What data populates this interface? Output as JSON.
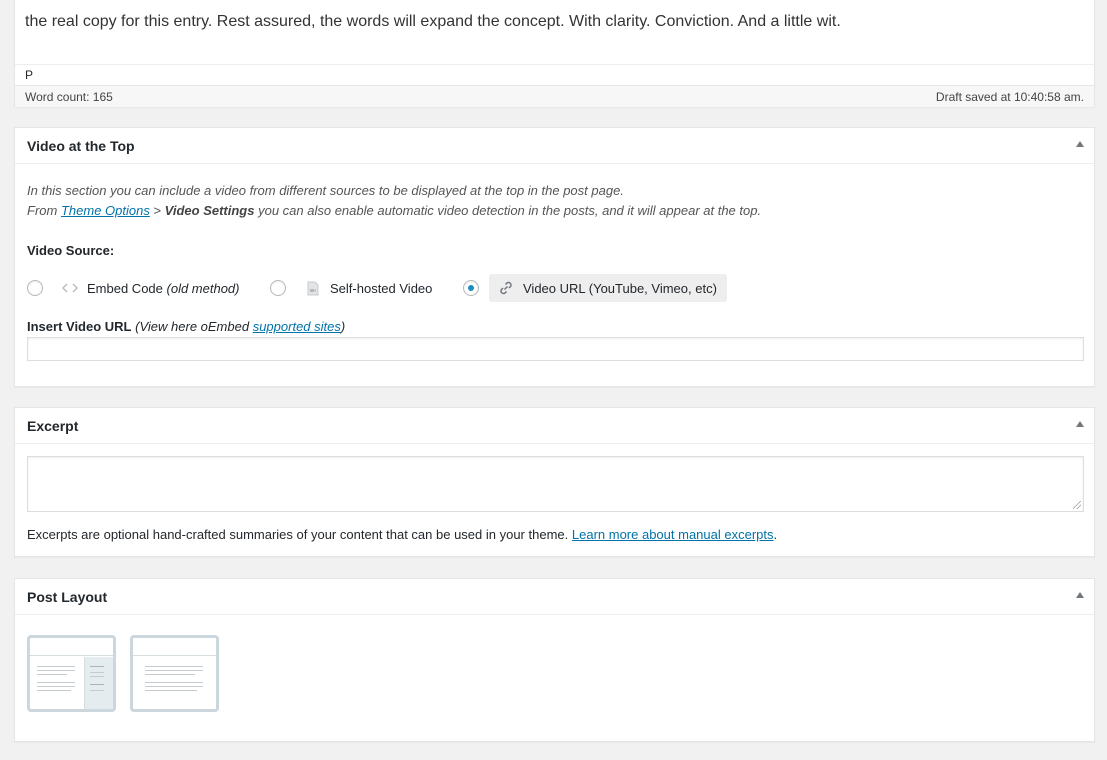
{
  "editor": {
    "visible_text_line": "the real copy for this entry. Rest assured, the words will expand the concept. With clarity. Conviction. And a little wit.",
    "path_label": "P",
    "word_count": "Word count: 165",
    "draft_status": "Draft saved at 10:40:58 am."
  },
  "video_box": {
    "title": "Video at the Top",
    "desc_line1": "In this section you can include a video from different sources to be displayed at the top in the post page.",
    "desc_from": "From",
    "desc_theme_options": "Theme Options",
    "desc_gt": " > ",
    "desc_video_settings": "Video Settings",
    "desc_rest": " you can also enable automatic video detection in the posts, and it will appear at the top.",
    "source_label": "Video Source:",
    "options": [
      {
        "label": "Embed Code",
        "note": "(old method)",
        "icon": "code-icon",
        "checked": false
      },
      {
        "label": "Self-hosted Video",
        "note": "",
        "icon": "video-file-icon",
        "checked": false
      },
      {
        "label": "Video URL (YouTube, Vimeo, etc)",
        "note": "",
        "icon": "link-icon",
        "checked": true
      }
    ],
    "insert_label": "Insert Video URL",
    "insert_note": "(View here oEmbed",
    "insert_link": "supported sites",
    "insert_close": ")",
    "url_value": ""
  },
  "excerpt_box": {
    "title": "Excerpt",
    "value": "",
    "help": "Excerpts are optional hand-crafted summaries of your content that can be used in your theme.",
    "help_link": "Learn more about manual excerpts",
    "help_end": "."
  },
  "layout_box": {
    "title": "Post Layout",
    "layouts": [
      "content-sidebar",
      "full-width"
    ]
  },
  "colors": {
    "link": "#0073aa",
    "radio_checked": "#1e8cbe",
    "background": "#f1f1f1"
  }
}
